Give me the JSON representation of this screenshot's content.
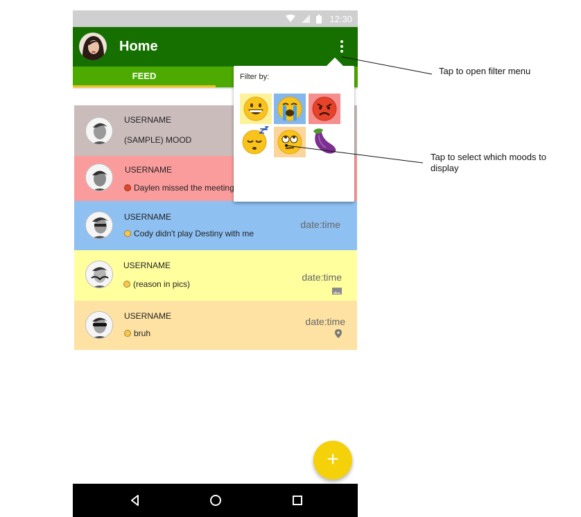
{
  "statusbar": {
    "time": "12:30"
  },
  "appbar": {
    "title": "Home"
  },
  "tabs": [
    {
      "label": "FEED"
    }
  ],
  "filter_popup": {
    "title": "Filter by:",
    "options": [
      {
        "name": "grinning",
        "bg": "#fdf29a"
      },
      {
        "name": "crying",
        "bg": "#85b6ec"
      },
      {
        "name": "angry",
        "bg": "#f58e8e"
      },
      {
        "name": "sleepy",
        "bg": "#ffffff"
      },
      {
        "name": "eye-roll",
        "bg": "#fbd59b"
      },
      {
        "name": "eggplant",
        "bg": "#ffffff"
      }
    ]
  },
  "feed": [
    {
      "username": "USERNAME",
      "mood": "(SAMPLE) MOOD",
      "bg": "#cbbcbc"
    },
    {
      "username": "USERNAME",
      "mood": "Daylen missed the meeting",
      "mood_color": "#e0472b",
      "bg": "#fb9c9c"
    },
    {
      "username": "USERNAME",
      "mood": "Cody didn't play Destiny with me",
      "mood_color": "#f7c64b",
      "date": "date:time",
      "bg": "#8ec0f2"
    },
    {
      "username": "USERNAME",
      "mood": "(reason in pics)",
      "mood_color": "#f7c64b",
      "date": "date:time",
      "attachment": "image-icon",
      "bg": "#ffff9e"
    },
    {
      "username": "USERNAME",
      "mood": "bruh",
      "mood_color": "#f7c64b",
      "date": "date:time",
      "attachment": "location-pin-icon",
      "bg": "#fde2a4"
    }
  ],
  "annotations": {
    "filter_menu": "Tap to open filter menu",
    "select_moods": "Tap to select which moods to display"
  },
  "colors": {
    "appbar": "#167000",
    "tabbar": "#4caa00",
    "tab_indicator": "#f1c40f",
    "fab": "#f5d10a",
    "statusbar": "#cfcfcf"
  }
}
